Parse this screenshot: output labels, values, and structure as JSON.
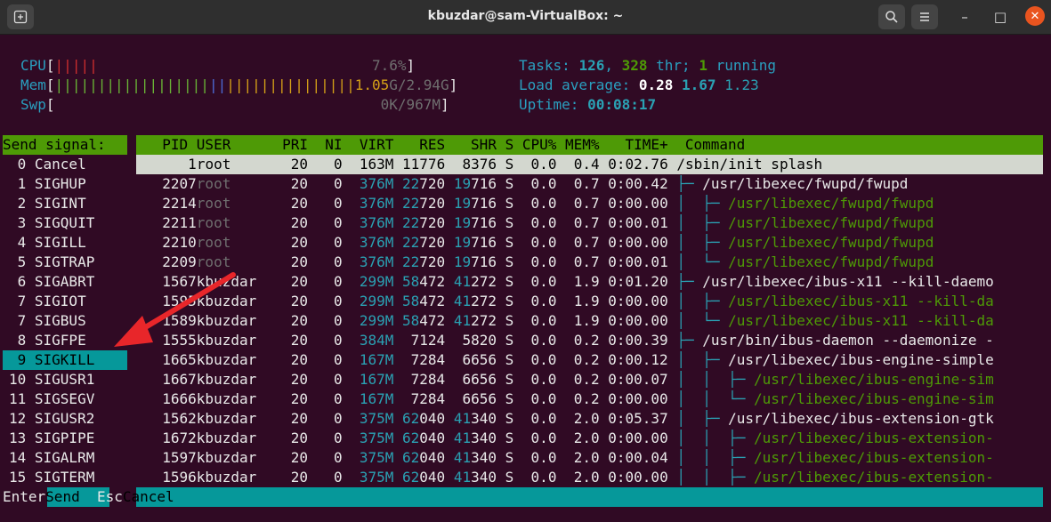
{
  "window": {
    "title": "kbuzdar@sam-VirtualBox: ~",
    "new_tab_icon": "terminal-icon",
    "search_icon": "search-icon",
    "menu_icon": "hamburger-icon",
    "minimize_glyph": "–",
    "maximize_glyph": "□",
    "close_glyph": "✕"
  },
  "meters": {
    "cpu_label": "CPU",
    "cpu_value": "7.6%",
    "mem_label": "Mem",
    "mem_value_used": "1.05",
    "mem_value_rest": "G/2.94G",
    "swp_label": "Swp",
    "swp_value": "0K/967M",
    "tasks_label": "Tasks: ",
    "tasks_count": "126",
    "tasks_sep": ", ",
    "threads": "328",
    "threads_label": " thr; ",
    "running": "1",
    "running_label": " running",
    "load_label": "Load average: ",
    "load1": "0.28",
    "load5": "1.67",
    "load15": "1.23",
    "uptime_label": "Uptime: ",
    "uptime": "00:08:17"
  },
  "signal_panel": {
    "header": "Send signal:",
    "selected_index": 9,
    "signals": [
      " 0 Cancel",
      " 1 SIGHUP",
      " 2 SIGINT",
      " 3 SIGQUIT",
      " 4 SIGILL",
      " 5 SIGTRAP",
      " 6 SIGABRT",
      " 7 SIGIOT",
      " 7 SIGBUS",
      " 8 SIGFPE",
      " 9 SIGKILL",
      "10 SIGUSR1",
      "11 SIGSEGV",
      "12 SIGUSR2",
      "13 SIGPIPE",
      "14 SIGALRM",
      "15 SIGTERM"
    ]
  },
  "columns": [
    "PID",
    "USER",
    "PRI",
    "NI",
    "VIRT",
    "RES",
    "SHR",
    "S",
    "CPU%",
    "MEM%",
    "TIME+",
    "Command"
  ],
  "header_line": "  PID USER      PRI  NI  VIRT   RES   SHR S CPU% MEM%   TIME+  Command",
  "processes": [
    {
      "pid": "1",
      "user": "root",
      "pri": "20",
      "ni": "0",
      "virt": "163M",
      "res": "11776",
      "shr": "8376",
      "s": "S",
      "cpu": "0.0",
      "mem": "0.4",
      "time": "0:02.76",
      "tree": "",
      "cmd": "/sbin/init splash",
      "thread": false,
      "userdim": false
    },
    {
      "pid": "2207",
      "user": "root",
      "pri": "20",
      "ni": "0",
      "virt": "376M",
      "res": "22720",
      "shr": "19716",
      "s": "S",
      "cpu": "0.0",
      "mem": "0.7",
      "time": "0:00.42",
      "tree": "├─ ",
      "cmd": "/usr/libexec/fwupd/fwupd",
      "thread": false,
      "userdim": true
    },
    {
      "pid": "2214",
      "user": "root",
      "pri": "20",
      "ni": "0",
      "virt": "376M",
      "res": "22720",
      "shr": "19716",
      "s": "S",
      "cpu": "0.0",
      "mem": "0.7",
      "time": "0:00.00",
      "tree": "│  ├─ ",
      "cmd": "/usr/libexec/fwupd/fwupd",
      "thread": true,
      "userdim": true
    },
    {
      "pid": "2211",
      "user": "root",
      "pri": "20",
      "ni": "0",
      "virt": "376M",
      "res": "22720",
      "shr": "19716",
      "s": "S",
      "cpu": "0.0",
      "mem": "0.7",
      "time": "0:00.01",
      "tree": "│  ├─ ",
      "cmd": "/usr/libexec/fwupd/fwupd",
      "thread": true,
      "userdim": true
    },
    {
      "pid": "2210",
      "user": "root",
      "pri": "20",
      "ni": "0",
      "virt": "376M",
      "res": "22720",
      "shr": "19716",
      "s": "S",
      "cpu": "0.0",
      "mem": "0.7",
      "time": "0:00.00",
      "tree": "│  ├─ ",
      "cmd": "/usr/libexec/fwupd/fwupd",
      "thread": true,
      "userdim": true
    },
    {
      "pid": "2209",
      "user": "root",
      "pri": "20",
      "ni": "0",
      "virt": "376M",
      "res": "22720",
      "shr": "19716",
      "s": "S",
      "cpu": "0.0",
      "mem": "0.7",
      "time": "0:00.01",
      "tree": "│  └─ ",
      "cmd": "/usr/libexec/fwupd/fwupd",
      "thread": true,
      "userdim": true
    },
    {
      "pid": "1567",
      "user": "kbuzdar",
      "pri": "20",
      "ni": "0",
      "virt": "299M",
      "res": "58472",
      "shr": "41272",
      "s": "S",
      "cpu": "0.0",
      "mem": "1.9",
      "time": "0:01.20",
      "tree": "├─ ",
      "cmd": "/usr/libexec/ibus-x11 --kill-daemo",
      "thread": false,
      "userdim": false
    },
    {
      "pid": "1595",
      "user": "kbuzdar",
      "pri": "20",
      "ni": "0",
      "virt": "299M",
      "res": "58472",
      "shr": "41272",
      "s": "S",
      "cpu": "0.0",
      "mem": "1.9",
      "time": "0:00.00",
      "tree": "│  ├─ ",
      "cmd": "/usr/libexec/ibus-x11 --kill-da",
      "thread": true,
      "userdim": false
    },
    {
      "pid": "1589",
      "user": "kbuzdar",
      "pri": "20",
      "ni": "0",
      "virt": "299M",
      "res": "58472",
      "shr": "41272",
      "s": "S",
      "cpu": "0.0",
      "mem": "1.9",
      "time": "0:00.00",
      "tree": "│  └─ ",
      "cmd": "/usr/libexec/ibus-x11 --kill-da",
      "thread": true,
      "userdim": false
    },
    {
      "pid": "1555",
      "user": "kbuzdar",
      "pri": "20",
      "ni": "0",
      "virt": "384M",
      "res": "7124",
      "shr": "5820",
      "s": "S",
      "cpu": "0.0",
      "mem": "0.2",
      "time": "0:00.39",
      "tree": "├─ ",
      "cmd": "/usr/bin/ibus-daemon --daemonize -",
      "thread": false,
      "userdim": false
    },
    {
      "pid": "1665",
      "user": "kbuzdar",
      "pri": "20",
      "ni": "0",
      "virt": "167M",
      "res": "7284",
      "shr": "6656",
      "s": "S",
      "cpu": "0.0",
      "mem": "0.2",
      "time": "0:00.12",
      "tree": "│  ├─ ",
      "cmd": "/usr/libexec/ibus-engine-simple",
      "thread": false,
      "userdim": false
    },
    {
      "pid": "1667",
      "user": "kbuzdar",
      "pri": "20",
      "ni": "0",
      "virt": "167M",
      "res": "7284",
      "shr": "6656",
      "s": "S",
      "cpu": "0.0",
      "mem": "0.2",
      "time": "0:00.07",
      "tree": "│  │  ├─ ",
      "cmd": "/usr/libexec/ibus-engine-sim",
      "thread": true,
      "userdim": false
    },
    {
      "pid": "1666",
      "user": "kbuzdar",
      "pri": "20",
      "ni": "0",
      "virt": "167M",
      "res": "7284",
      "shr": "6656",
      "s": "S",
      "cpu": "0.0",
      "mem": "0.2",
      "time": "0:00.00",
      "tree": "│  │  └─ ",
      "cmd": "/usr/libexec/ibus-engine-sim",
      "thread": true,
      "userdim": false
    },
    {
      "pid": "1562",
      "user": "kbuzdar",
      "pri": "20",
      "ni": "0",
      "virt": "375M",
      "res": "62040",
      "shr": "41340",
      "s": "S",
      "cpu": "0.0",
      "mem": "2.0",
      "time": "0:05.37",
      "tree": "│  ├─ ",
      "cmd": "/usr/libexec/ibus-extension-gtk",
      "thread": false,
      "userdim": false
    },
    {
      "pid": "1672",
      "user": "kbuzdar",
      "pri": "20",
      "ni": "0",
      "virt": "375M",
      "res": "62040",
      "shr": "41340",
      "s": "S",
      "cpu": "0.0",
      "mem": "2.0",
      "time": "0:00.00",
      "tree": "│  │  ├─ ",
      "cmd": "/usr/libexec/ibus-extension-",
      "thread": true,
      "userdim": false
    },
    {
      "pid": "1597",
      "user": "kbuzdar",
      "pri": "20",
      "ni": "0",
      "virt": "375M",
      "res": "62040",
      "shr": "41340",
      "s": "S",
      "cpu": "0.0",
      "mem": "2.0",
      "time": "0:00.04",
      "tree": "│  │  ├─ ",
      "cmd": "/usr/libexec/ibus-extension-",
      "thread": true,
      "userdim": false
    },
    {
      "pid": "1596",
      "user": "kbuzdar",
      "pri": "20",
      "ni": "0",
      "virt": "375M",
      "res": "62040",
      "shr": "41340",
      "s": "S",
      "cpu": "0.0",
      "mem": "2.0",
      "time": "0:00.00",
      "tree": "│  │  ├─ ",
      "cmd": "/usr/libexec/ibus-extension-",
      "thread": true,
      "userdim": false
    }
  ],
  "footer": {
    "enter_key": "Enter",
    "enter_action": "Send  ",
    "esc_key": "Esc",
    "esc_action": "Cancel"
  },
  "colors": {
    "header_bg": "#4e9a06",
    "selection_bg": "#06989a",
    "arrow": "#e8262a"
  }
}
